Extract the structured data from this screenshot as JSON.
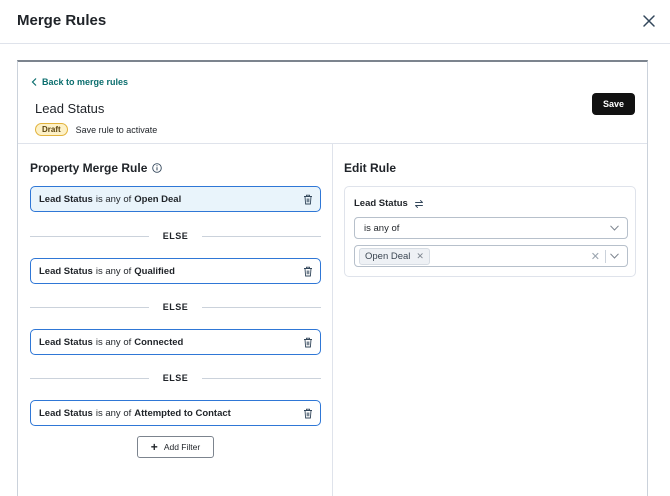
{
  "modal": {
    "title": "Merge Rules"
  },
  "header": {
    "back_label": "Back to merge rules",
    "rule_title": "Lead Status",
    "badge": "Draft",
    "badge_note": "Save rule to activate",
    "save_label": "Save"
  },
  "left": {
    "title": "Property Merge Rule",
    "rules": [
      {
        "property": "Lead Status",
        "operator": "is any of",
        "value": "Open Deal"
      },
      {
        "property": "Lead Status",
        "operator": "is any of",
        "value": "Qualified"
      },
      {
        "property": "Lead Status",
        "operator": "is any of",
        "value": "Connected"
      },
      {
        "property": "Lead Status",
        "operator": "is any of",
        "value": "Attempted to Contact"
      }
    ],
    "else_label": "ELSE",
    "add_filter_label": "Add Filter"
  },
  "right": {
    "title": "Edit Rule",
    "field_label": "Lead Status",
    "operator_value": "is any of",
    "selected_tags": [
      "Open Deal"
    ]
  },
  "colors": {
    "accent": "#2f77d6",
    "link": "#0b6e6e",
    "draft_bg": "#fdf1c7"
  }
}
